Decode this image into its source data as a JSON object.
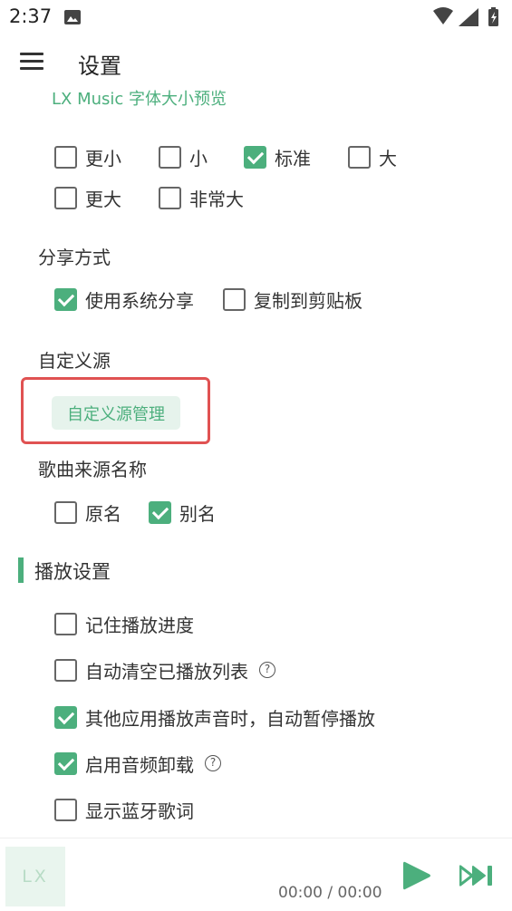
{
  "status_bar": {
    "time": "2:37",
    "icons": [
      "image-icon",
      "wifi-icon",
      "signal-icon",
      "battery-icon"
    ]
  },
  "header": {
    "title": "设置",
    "menu_icon": "menu-icon"
  },
  "font_size": {
    "preview": "LX Music 字体大小预览",
    "options": [
      {
        "label": "更小",
        "checked": false
      },
      {
        "label": "小",
        "checked": false
      },
      {
        "label": "标准",
        "checked": true
      },
      {
        "label": "大",
        "checked": false
      },
      {
        "label": "更大",
        "checked": false
      },
      {
        "label": "非常大",
        "checked": false
      }
    ]
  },
  "share": {
    "title": "分享方式",
    "options": [
      {
        "label": "使用系统分享",
        "checked": true
      },
      {
        "label": "复制到剪贴板",
        "checked": false
      }
    ]
  },
  "custom_source": {
    "title": "自定义源",
    "button_label": "自定义源管理"
  },
  "source_name": {
    "title": "歌曲来源名称",
    "options": [
      {
        "label": "原名",
        "checked": false
      },
      {
        "label": "别名",
        "checked": true
      }
    ]
  },
  "playback": {
    "title": "播放设置",
    "options": [
      {
        "label": "记住播放进度",
        "checked": false,
        "help": false
      },
      {
        "label": "自动清空已播放列表",
        "checked": false,
        "help": true
      },
      {
        "label": "其他应用播放声音时，自动暂停播放",
        "checked": true,
        "help": false
      },
      {
        "label": "启用音频卸载",
        "checked": true,
        "help": true
      },
      {
        "label": "显示蓝牙歌词",
        "checked": false,
        "help": false
      }
    ],
    "help_glyph": "?"
  },
  "player": {
    "album_placeholder": "LX",
    "time": "00:00 / 00:00"
  },
  "colors": {
    "accent": "#4caf7d",
    "highlight": "#e05252",
    "text": "#333333"
  }
}
